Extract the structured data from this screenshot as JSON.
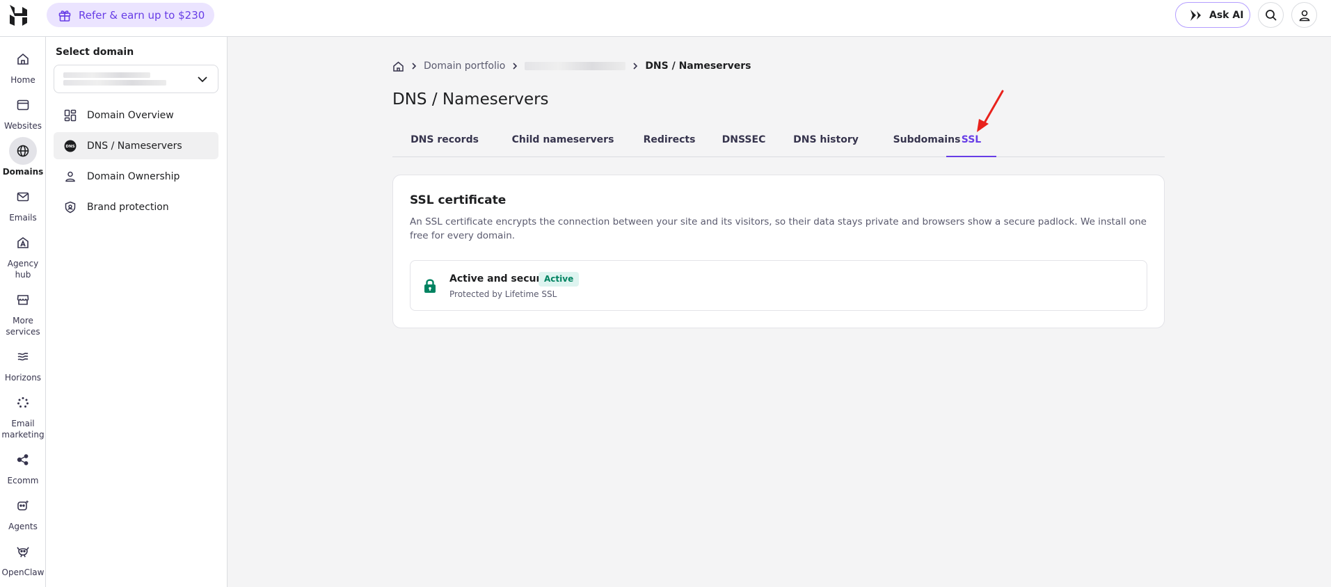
{
  "topbar": {
    "refer_label": "Refer & earn up to $230",
    "ask_ai_label": "Ask AI"
  },
  "rail": {
    "items": [
      {
        "label": "Home",
        "icon": "home-icon"
      },
      {
        "label": "Websites",
        "icon": "browser-icon"
      },
      {
        "label": "Domains",
        "icon": "globe-icon"
      },
      {
        "label": "Emails",
        "icon": "mail-icon"
      },
      {
        "label": "Agency hub",
        "icon": "agency-icon"
      },
      {
        "label": "More services",
        "icon": "store-icon"
      },
      {
        "label": "Horizons",
        "icon": "horizons-icon"
      },
      {
        "label": "Email marketing",
        "icon": "email-marketing-icon"
      },
      {
        "label": "Ecomm",
        "icon": "ecomm-icon"
      },
      {
        "label": "Agents",
        "icon": "agents-icon"
      },
      {
        "label": "OpenClaw",
        "icon": "openclaw-icon"
      }
    ],
    "active": "Domains"
  },
  "sidebar": {
    "title": "Select domain",
    "items": [
      {
        "label": "Domain Overview",
        "icon": "dashboard-icon"
      },
      {
        "label": "DNS / Nameservers",
        "icon": "dns-icon"
      },
      {
        "label": "Domain Ownership",
        "icon": "person-icon"
      },
      {
        "label": "Brand protection",
        "icon": "shield-icon"
      }
    ],
    "active": "DNS / Nameservers"
  },
  "breadcrumb": {
    "portfolio": "Domain portfolio",
    "current": "DNS / Nameservers"
  },
  "page": {
    "title": "DNS / Nameservers"
  },
  "tabs": [
    {
      "label": "DNS records"
    },
    {
      "label": "Child nameservers"
    },
    {
      "label": "Redirects"
    },
    {
      "label": "DNSSEC"
    },
    {
      "label": "DNS history"
    },
    {
      "label": "Subdomains"
    },
    {
      "label": "SSL"
    }
  ],
  "active_tab": "SSL",
  "ssl_card": {
    "title": "SSL certificate",
    "description": "An SSL certificate encrypts the connection between your site and its visitors, so their data stays private and browsers show a secure padlock. We install one free for every domain.",
    "status_title": "Active and secure",
    "badge": "Active",
    "status_sub": "Protected by Lifetime SSL"
  },
  "colors": {
    "accent": "#673de6",
    "success": "#008361",
    "success_bg": "#def4f0",
    "annotation_arrow": "#e8221c"
  }
}
